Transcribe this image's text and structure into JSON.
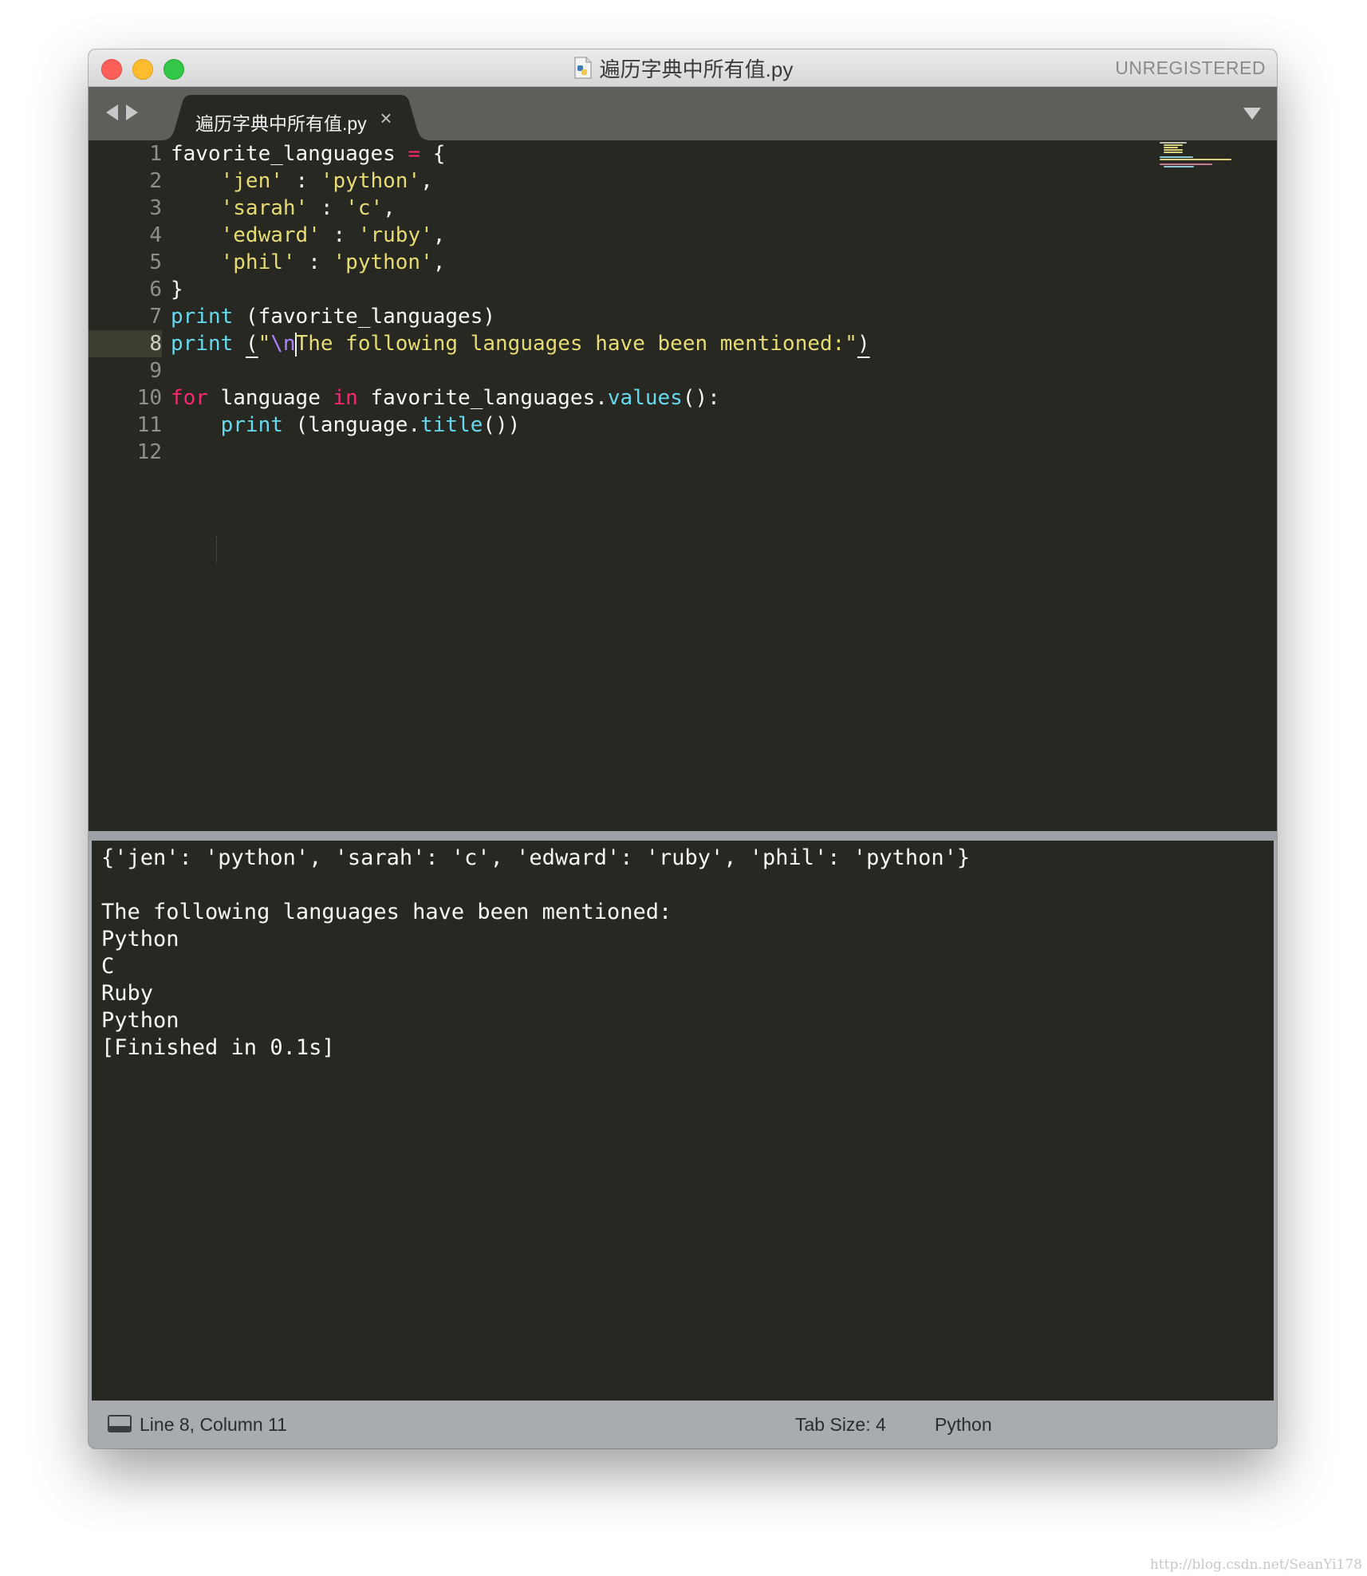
{
  "window": {
    "title": "遍历字典中所有值.py",
    "registration": "UNREGISTERED"
  },
  "tabs": [
    {
      "label": "遍历字典中所有值.py",
      "close": "×"
    }
  ],
  "editor": {
    "line_numbers": [
      "1",
      "2",
      "3",
      "4",
      "5",
      "6",
      "7",
      "8",
      "9",
      "10",
      "11",
      "12"
    ],
    "active_line": "8",
    "lines": [
      {
        "segments": [
          {
            "t": "favorite_languages "
          },
          {
            "t": "=",
            "c": "k"
          },
          {
            "t": " {"
          }
        ]
      },
      {
        "segments": [
          {
            "t": "    "
          },
          {
            "t": "'jen'",
            "c": "s"
          },
          {
            "t": " : "
          },
          {
            "t": "'python'",
            "c": "s"
          },
          {
            "t": ","
          }
        ]
      },
      {
        "segments": [
          {
            "t": "    "
          },
          {
            "t": "'sarah'",
            "c": "s"
          },
          {
            "t": " : "
          },
          {
            "t": "'c'",
            "c": "s"
          },
          {
            "t": ","
          }
        ]
      },
      {
        "segments": [
          {
            "t": "    "
          },
          {
            "t": "'edward'",
            "c": "s"
          },
          {
            "t": " : "
          },
          {
            "t": "'ruby'",
            "c": "s"
          },
          {
            "t": ","
          }
        ]
      },
      {
        "segments": [
          {
            "t": "    "
          },
          {
            "t": "'phil'",
            "c": "s"
          },
          {
            "t": " : "
          },
          {
            "t": "'python'",
            "c": "s"
          },
          {
            "t": ","
          }
        ]
      },
      {
        "segments": [
          {
            "t": "}"
          }
        ]
      },
      {
        "segments": [
          {
            "t": "print",
            "c": "f"
          },
          {
            "t": " (favorite_languages)"
          }
        ]
      },
      {
        "segments": [
          {
            "t": "print",
            "c": "f"
          },
          {
            "t": " "
          },
          {
            "t": "(",
            "c": "u"
          },
          {
            "t": "\"",
            "c": "s"
          },
          {
            "t": "\\n",
            "c": "e"
          },
          {
            "t": "CURSOR",
            "c": "cursor"
          },
          {
            "t": "The following languages have been mentioned:\"",
            "c": "s"
          },
          {
            "t": ")",
            "c": "u"
          }
        ]
      },
      {
        "segments": [
          {
            "t": ""
          }
        ]
      },
      {
        "segments": [
          {
            "t": "for",
            "c": "k"
          },
          {
            "t": " language "
          },
          {
            "t": "in",
            "c": "k"
          },
          {
            "t": " favorite_languages."
          },
          {
            "t": "values",
            "c": "f"
          },
          {
            "t": "():"
          }
        ]
      },
      {
        "segments": [
          {
            "t": "    "
          },
          {
            "t": "print",
            "c": "f"
          },
          {
            "t": " (language."
          },
          {
            "t": "title",
            "c": "f"
          },
          {
            "t": "())"
          }
        ]
      },
      {
        "segments": [
          {
            "t": ""
          }
        ]
      }
    ]
  },
  "output": {
    "lines": [
      "{'jen': 'python', 'sarah': 'c', 'edward': 'ruby', 'phil': 'python'}",
      "",
      "The following languages have been mentioned:",
      "Python",
      "C",
      "Ruby",
      "Python",
      "[Finished in 0.1s]"
    ]
  },
  "status": {
    "position": "Line 8, Column 11",
    "tab_size": "Tab Size: 4",
    "syntax": "Python"
  },
  "watermark": "http://blog.csdn.net/SeanYi178",
  "colors": {
    "keyword": "#f92672",
    "string": "#e6db74",
    "function": "#66d9ef",
    "escape": "#ae81ff",
    "background": "#272822"
  }
}
